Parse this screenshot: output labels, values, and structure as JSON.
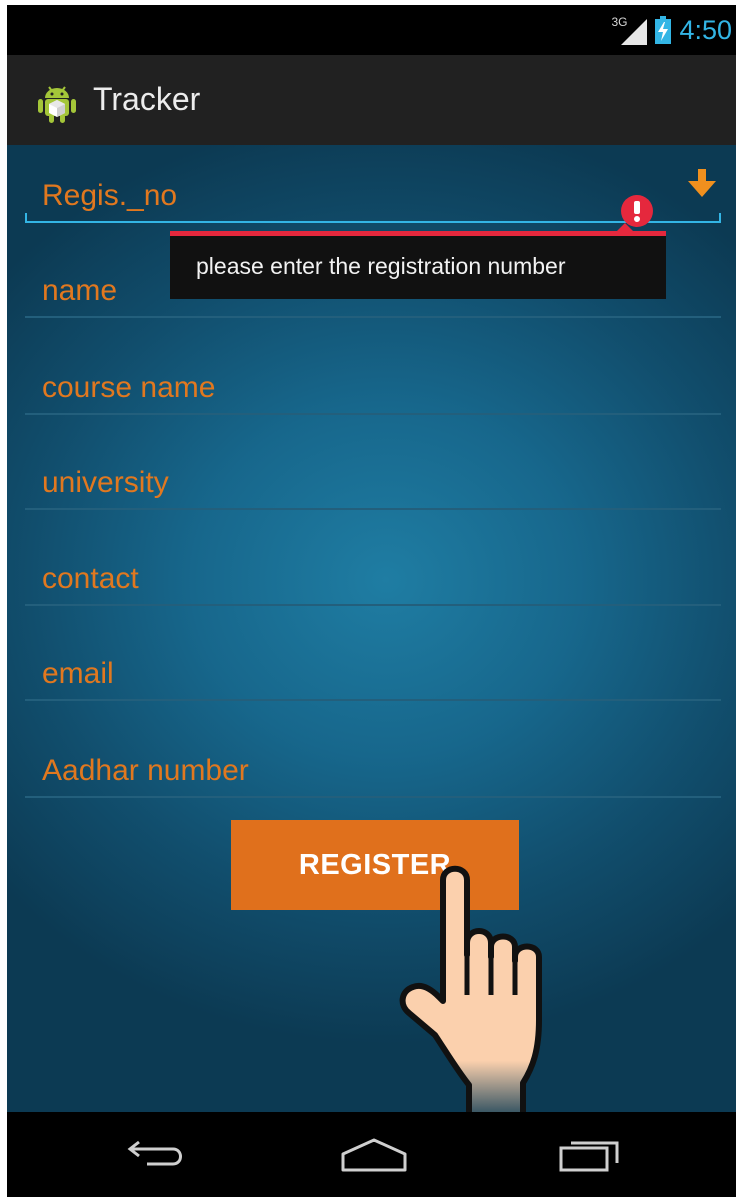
{
  "status_bar": {
    "network_label": "3G",
    "time": "4:50",
    "clock_color": "#33b5e5",
    "icons": [
      "signal-icon",
      "battery-charging-icon"
    ]
  },
  "action_bar": {
    "app_title": "Tracker",
    "app_icon": "android-app-icon"
  },
  "form": {
    "fields": [
      {
        "name": "registration-number-field",
        "value": "Regis._no",
        "focused": true
      },
      {
        "name": "name-field",
        "value": "name"
      },
      {
        "name": "course-name-field",
        "value": "course name"
      },
      {
        "name": "university-field",
        "value": "university"
      },
      {
        "name": "contact-field",
        "value": "contact"
      },
      {
        "name": "email-field",
        "value": "email"
      },
      {
        "name": "aadhar-number-field",
        "value": "Aadhar number"
      }
    ],
    "error_message": "please enter the registration number",
    "register_label": "REGISTER",
    "accent_color": "#e1781f",
    "button_color": "#e0701c",
    "error_color": "#e5283d"
  },
  "nav_bar": {
    "icons": [
      "back-icon",
      "home-icon",
      "recent-apps-icon"
    ]
  }
}
